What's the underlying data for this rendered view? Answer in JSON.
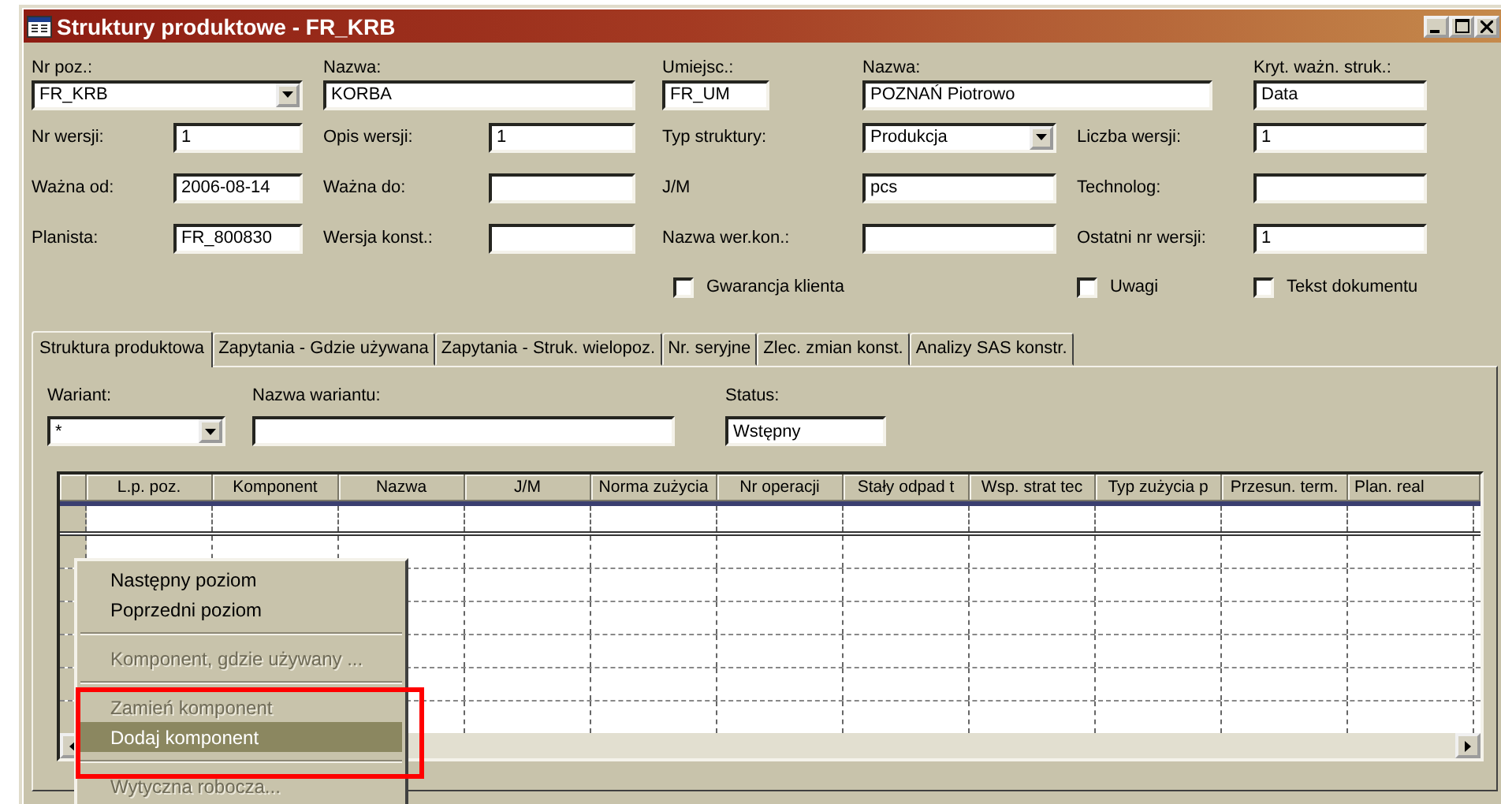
{
  "window": {
    "title": "Struktury produktowe - FR_KRB"
  },
  "header": {
    "fields": [
      {
        "label": "Nr poz.:",
        "value": "FR_KRB",
        "kind": "combo"
      },
      {
        "label": "Nazwa:",
        "value": "KORBA",
        "kind": "text"
      },
      {
        "label": "Umiejsc.:",
        "value": "FR_UM",
        "kind": "text"
      },
      {
        "label": "Nazwa:",
        "value": "POZNAŃ Piotrowo",
        "kind": "text"
      },
      {
        "label": "Kryt. ważn. struk.:",
        "value": "Data",
        "kind": "text"
      },
      {
        "label": "Nr wersji:",
        "value": "1",
        "kind": "text"
      },
      {
        "label": "Opis wersji:",
        "value": "1",
        "kind": "text"
      },
      {
        "label": "Typ struktury:",
        "value": "Produkcja",
        "kind": "combo"
      },
      {
        "label": "Liczba wersji:",
        "value": "1",
        "kind": "text"
      },
      {
        "label": "Ważna od:",
        "value": "2006-08-14",
        "kind": "text"
      },
      {
        "label": "Ważna do:",
        "kind": "text"
      },
      {
        "label": "J/M",
        "value": "pcs",
        "kind": "text"
      },
      {
        "label": "Technolog:",
        "kind": "text"
      },
      {
        "label": "Planista:",
        "value": "FR_800830",
        "kind": "text"
      },
      {
        "label": "Wersja konst.:",
        "kind": "text"
      },
      {
        "label": "Nazwa wer.kon.:",
        "kind": "text"
      },
      {
        "label": "Ostatni nr wersji:",
        "value": "1",
        "kind": "text"
      }
    ],
    "checkboxes": [
      {
        "label": "Gwarancja klienta",
        "checked": false
      },
      {
        "label": "Uwagi",
        "checked": false
      },
      {
        "label": "Tekst dokumentu",
        "checked": false
      }
    ]
  },
  "tabs": [
    {
      "label": "Struktura produktowa",
      "selected": true
    },
    {
      "label": "Zapytania - Gdzie używana",
      "selected": false
    },
    {
      "label": "Zapytania - Struk. wielopoz.",
      "selected": false
    },
    {
      "label": "Nr. seryjne",
      "selected": false
    },
    {
      "label": "Zlec. zmian konst.",
      "selected": false
    },
    {
      "label": "Analizy SAS konstr.",
      "selected": false
    }
  ],
  "variant_fields": [
    {
      "label": "Wariant:",
      "value": "*",
      "kind": "combo"
    },
    {
      "label": "Nazwa wariantu:",
      "kind": "text"
    },
    {
      "label": "Status:",
      "value": "Wstępny",
      "kind": "text"
    }
  ],
  "table": {
    "columns": [
      "L.p. poz.",
      "Komponent",
      "Nazwa",
      "J/M",
      "Norma zużycia",
      "Nr operacji",
      "Stały odpad t",
      "Wsp. strat tec",
      "Typ zużycia p",
      "Przesun. term.",
      "Plan. real"
    ],
    "rows": [
      {
        "selected": true
      },
      {
        "selected": false
      },
      {
        "selected": false
      },
      {
        "selected": false
      },
      {
        "selected": false
      },
      {
        "selected": false
      },
      {
        "selected": false
      }
    ]
  },
  "context_menu": {
    "items": [
      {
        "kind": "item",
        "label": "Następny poziom",
        "disabled": false,
        "selected": false,
        "framed": false
      },
      {
        "kind": "item",
        "label": "Poprzedni poziom",
        "disabled": false,
        "selected": false,
        "framed": false
      },
      {
        "kind": "separator"
      },
      {
        "kind": "item",
        "label": "Komponent, gdzie używany ...",
        "disabled": true,
        "selected": false,
        "framed": false
      },
      {
        "kind": "separator"
      },
      {
        "kind": "item",
        "label": "Zamień komponent",
        "disabled": true,
        "selected": false,
        "framed": true
      },
      {
        "kind": "item",
        "label": "Dodaj komponent",
        "disabled": false,
        "selected": true,
        "framed": true
      },
      {
        "kind": "separator"
      },
      {
        "kind": "item",
        "label": "Wytyczna robocza...",
        "disabled": true,
        "selected": false,
        "framed": false
      }
    ]
  }
}
